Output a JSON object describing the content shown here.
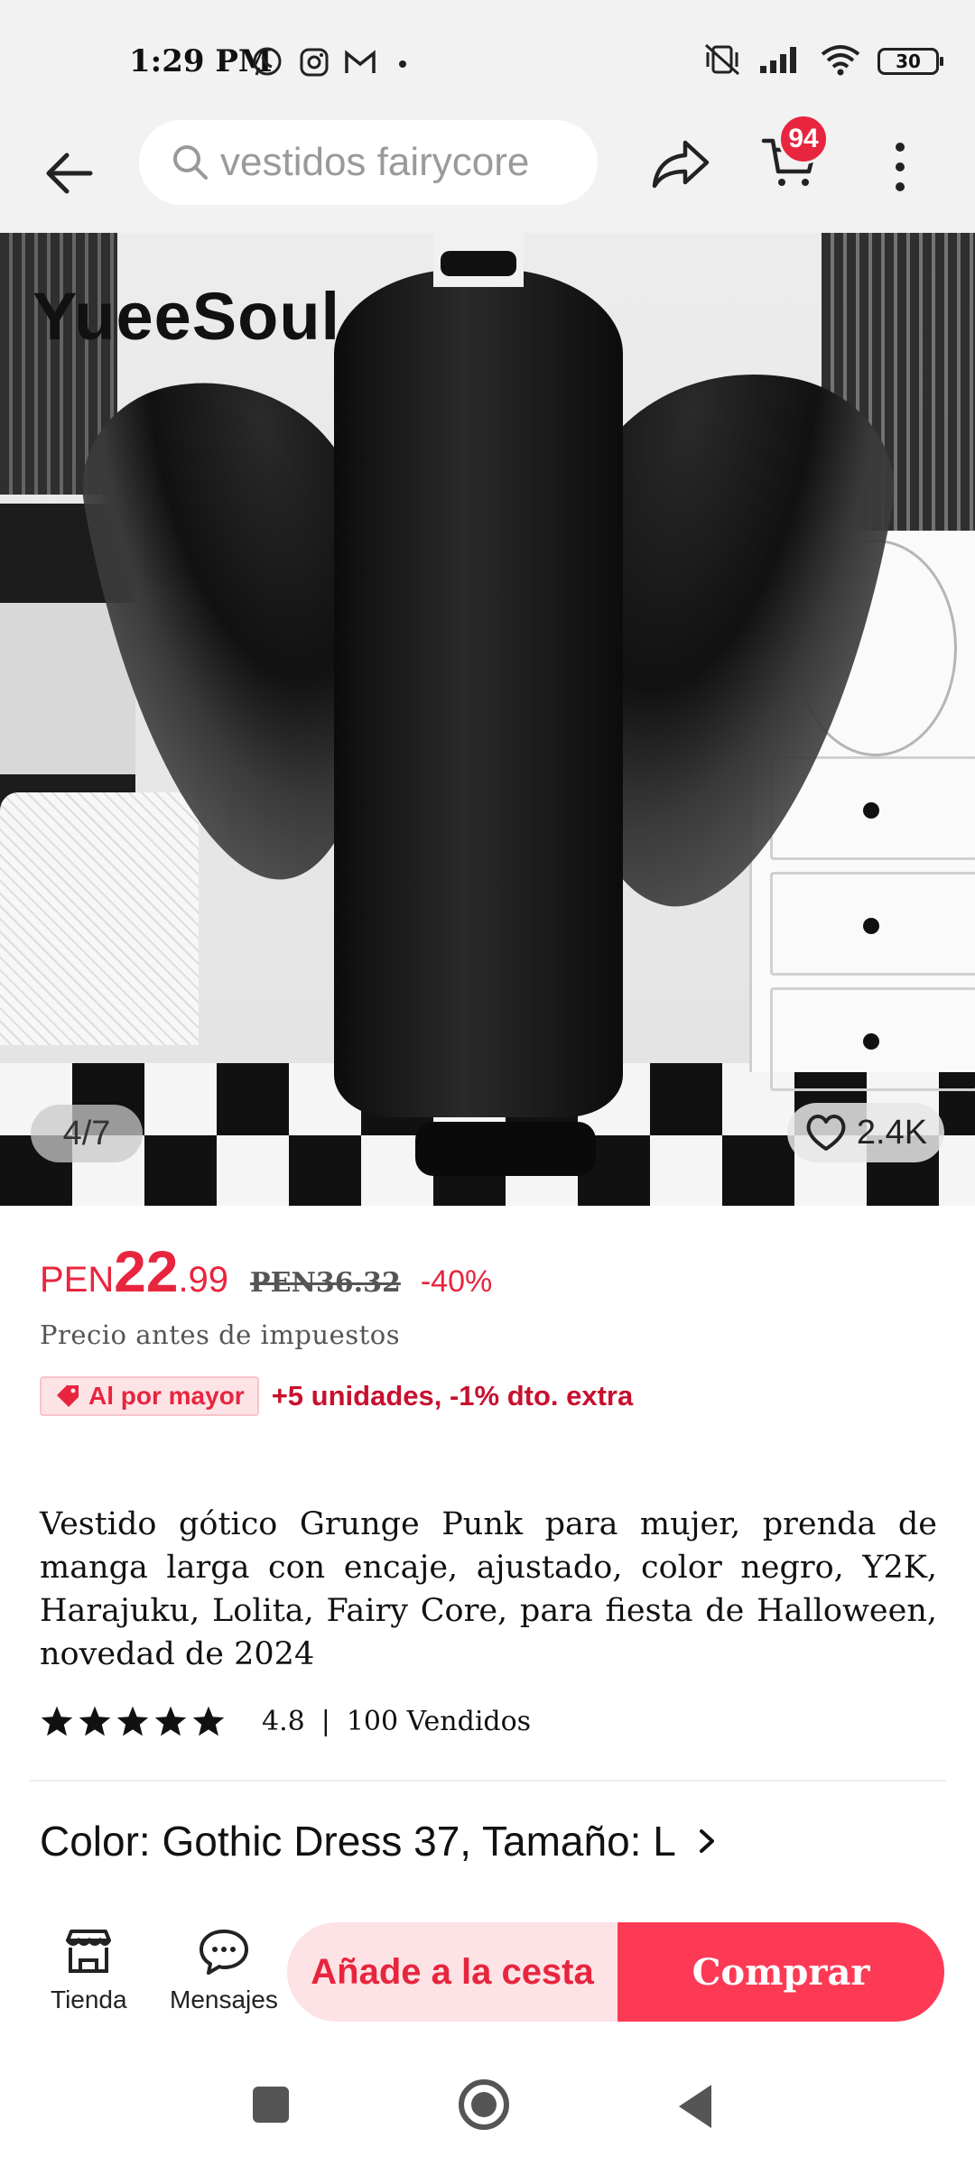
{
  "status_bar": {
    "time": "1:29 PM",
    "notification_icons": [
      "whatsapp-icon",
      "instagram-icon",
      "gmail-icon",
      "dot-icon"
    ],
    "right_icons": [
      "vibrate-icon",
      "signal-icon",
      "wifi-icon"
    ],
    "battery": "30"
  },
  "header": {
    "search_text": "vestidos fairycore",
    "cart_badge": "94"
  },
  "product_image": {
    "brand": "YueeSoul",
    "page_indicator": "4/7",
    "favorites": "2.4K"
  },
  "price": {
    "currency": "PEN",
    "integer": "22",
    "decimal": ".99",
    "original": "PEN36.32",
    "discount": "-40%",
    "tax_note": "Precio antes de impuestos"
  },
  "wholesale": {
    "tag": "Al por mayor",
    "text": "+5 unidades, -1% dto. extra"
  },
  "product": {
    "title": "Vestido gótico Grunge Punk para mujer, prenda de manga larga con encaje, ajustado, color negro, Y2K, Harajuku, Lolita, Fairy Core, para fiesta de Halloween, novedad de 2024",
    "rating": "4.8",
    "separator": "|",
    "sold": "100 Vendidos",
    "stars": 5
  },
  "variant": {
    "text": "Color: Gothic Dress 37, Tamaño: L"
  },
  "bottom_bar": {
    "store_label": "Tienda",
    "messages_label": "Mensajes",
    "add_to_cart": "Añade a la cesta",
    "buy": "Comprar"
  },
  "colors": {
    "accent": "#e8253e",
    "buy_button": "#fd3a55",
    "cart_button_bg": "#fde3e6",
    "header_bg": "#f2f2f2"
  }
}
